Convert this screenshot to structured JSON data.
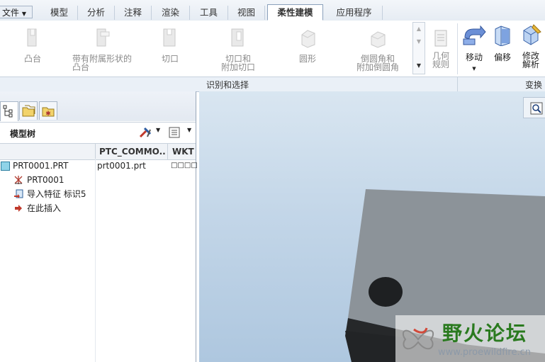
{
  "menubar": {
    "file_label": "文件",
    "tabs": [
      "模型",
      "分析",
      "注释",
      "渲染",
      "工具",
      "视图",
      "柔性建模",
      "应用程序"
    ],
    "active_tab": "柔性建模"
  },
  "ribbon": {
    "buttons": [
      {
        "label_line1": "凸台",
        "label_line2": ""
      },
      {
        "label_line1": "带有附属形状的",
        "label_line2": "凸台"
      },
      {
        "label_line1": "切口",
        "label_line2": ""
      },
      {
        "label_line1": "切口和",
        "label_line2": "附加切口"
      },
      {
        "label_line1": "圆形",
        "label_line2": ""
      },
      {
        "label_line1": "倒圆角和",
        "label_line2": "附加倒圆角"
      },
      {
        "label_line1": "几何",
        "label_line2": "规则"
      }
    ],
    "transform_buttons": [
      {
        "label_line1": "移动",
        "label_line2": ""
      },
      {
        "label_line1": "偏移",
        "label_line2": ""
      },
      {
        "label_line1": "修改",
        "label_line2": "解析"
      }
    ],
    "group_identify": "识别和选择",
    "group_transform": "变换"
  },
  "model_tree": {
    "title": "模型树",
    "columns": [
      "PTC_COMMO...",
      "WKT"
    ],
    "rows": [
      {
        "name": "PRT0001.PRT",
        "col1": "prt0001.prt",
        "col2": "□□□□"
      },
      {
        "name": "PRT0001",
        "col1": "",
        "col2": ""
      },
      {
        "name": "导入特征 标识5",
        "col1": "",
        "col2": ""
      },
      {
        "name": "在此插入",
        "col1": "",
        "col2": ""
      }
    ]
  },
  "watermark": {
    "title": "野火论坛",
    "url": "www.proewildfire.cn"
  },
  "colors": {
    "accent": "#1d5fa8",
    "viewport_top": "#d9e6f1",
    "viewport_bottom": "#aec7df",
    "part_face": "#8c9399"
  }
}
